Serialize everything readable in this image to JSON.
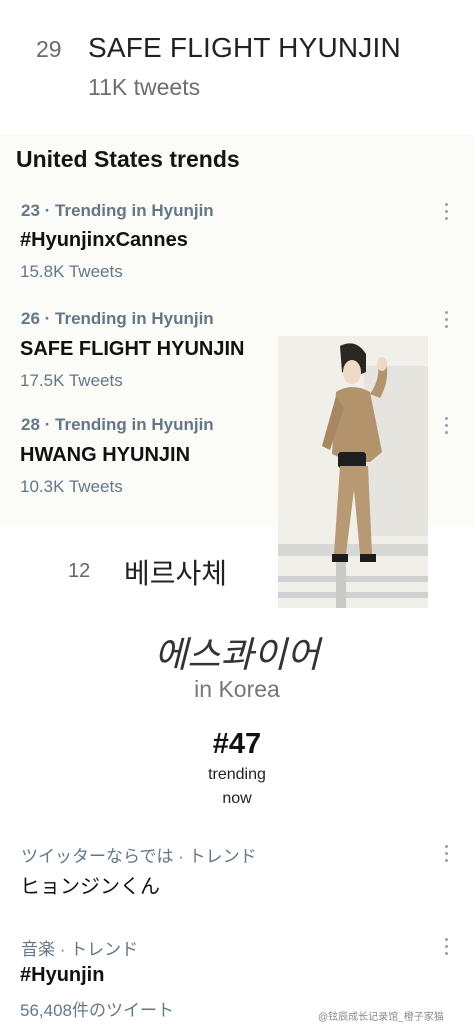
{
  "section1": {
    "rank": "29",
    "title": "SAFE FLIGHT HYUNJIN",
    "count": "11K tweets"
  },
  "us_trends": {
    "header": "United States trends",
    "items": [
      {
        "meta": "23 · Trending in Hyunjin",
        "name": "#HyunjinxCannes",
        "count": "15.8K Tweets"
      },
      {
        "meta": "26 · Trending in Hyunjin",
        "name": "SAFE FLIGHT HYUNJIN",
        "count": "17.5K Tweets"
      },
      {
        "meta": "28 · Trending in Hyunjin",
        "name": "HWANG HYUNJIN",
        "count": "10.3K Tweets"
      }
    ]
  },
  "section3": {
    "rank": "12",
    "title": "베르사체"
  },
  "section4": {
    "title": "에스콰이어",
    "subtitle": "in Korea",
    "rank": "#47",
    "trending_line1": "trending",
    "trending_line2": "now"
  },
  "jp_trends": [
    {
      "meta": "ツイッターならでは · トレンド",
      "name": "ヒョンジンくん"
    },
    {
      "meta": "音楽 · トレンド",
      "name": "#Hyunjin",
      "count": "56,408件のツイート"
    }
  ],
  "watermark": "@铉辰成长记录馆_橙子家猫",
  "icons": {
    "more": "more-vertical-icon"
  },
  "colors": {
    "secondary": "#657786",
    "panel_bg": "#fbfbf8"
  }
}
